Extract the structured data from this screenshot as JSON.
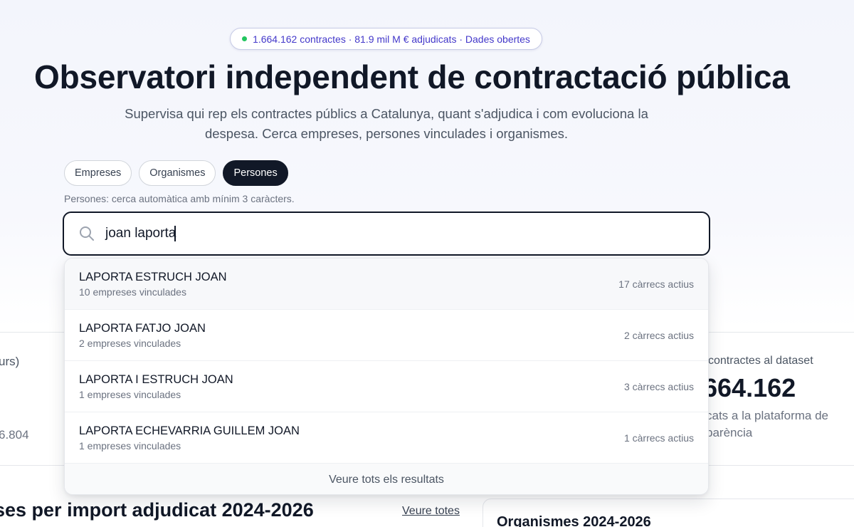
{
  "hero": {
    "badge": "1.664.162 contractes · 81.9 mil M € adjudicats · Dades obertes",
    "title": "Observatori independent de contractació pública",
    "subtitle": "Supervisa qui rep els contractes públics a Catalunya, quant s'adjudica i com evoluciona la despesa. Cerca empreses, persones vinculades i organismes."
  },
  "filters": [
    {
      "label": "Empreses",
      "active": false
    },
    {
      "label": "Organismes",
      "active": false
    },
    {
      "label": "Persones",
      "active": true
    }
  ],
  "search": {
    "hint": "Persones: cerca automàtica amb mínim 3 caràcters.",
    "value": "joan laporta"
  },
  "results": [
    {
      "name": "LAPORTA ESTRUCH JOAN",
      "sub": "10 empreses vinculades",
      "count": "17 càrrecs actius"
    },
    {
      "name": "LAPORTA FATJO JOAN",
      "sub": "2 empreses vinculades",
      "count": "2 càrrecs actius"
    },
    {
      "name": "LAPORTA I ESTRUCH JOAN",
      "sub": "1 empreses vinculades",
      "count": "3 càrrecs actius"
    },
    {
      "name": "LAPORTA ECHEVARRIA GUILLEM JOAN",
      "sub": "1 empreses vinculades",
      "count": "1 càrrecs actius"
    }
  ],
  "dropdown_footer": "Veure tots els resultats",
  "stats": {
    "left_label": "urs)",
    "left_value": "6.804",
    "right_label": "contractes al dataset",
    "right_value": "664.162",
    "right_desc": "cats a la plataforma de parència"
  },
  "sections": {
    "companies_title": "ses per import adjudicat 2024-2026",
    "companies_link": "Veure totes",
    "organisms_title": "Organismes 2024-2026"
  },
  "colors": {
    "accent": "#4338ca",
    "status_dot": "#22c55e",
    "dark": "#111827"
  }
}
